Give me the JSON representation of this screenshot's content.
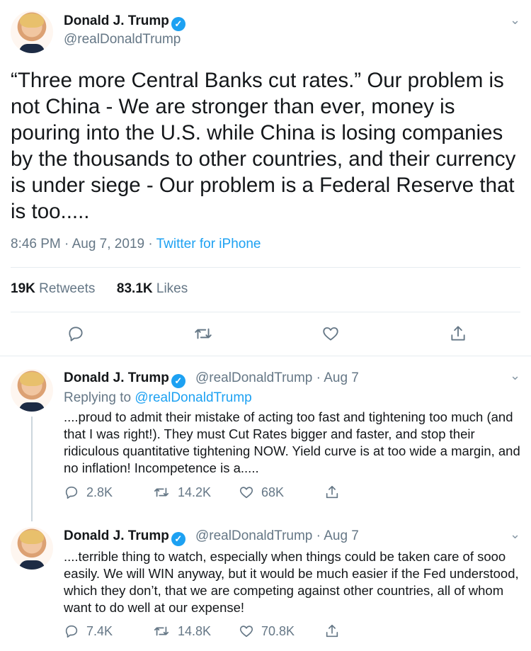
{
  "main_tweet": {
    "author_name": "Donald J. Trump",
    "author_handle": "@realDonaldTrump",
    "text": "“Three more Central Banks cut rates.” Our problem is not China - We are stronger than ever, money is pouring into the U.S. while China is losing companies by the thousands to other countries, and their currency is under siege - Our problem is a Federal Reserve that is too.....",
    "time": "8:46 PM · Aug 7, 2019 · ",
    "source": "Twitter for iPhone",
    "retweets_count": "19K",
    "retweets_label": "Retweets",
    "likes_count": "83.1K",
    "likes_label": "Likes"
  },
  "replies": [
    {
      "author_name": "Donald J. Trump",
      "author_handle": "@realDonaldTrump · Aug 7",
      "replying_prefix": "Replying to ",
      "replying_to": "@realDonaldTrump",
      "text": "....proud to admit their mistake of acting too fast and tightening too much (and that I was right!). They must Cut Rates bigger and faster, and stop their ridiculous quantitative tightening NOW. Yield curve is at too wide a margin, and no inflation! Incompetence is a.....",
      "replies": "2.8K",
      "retweets": "14.2K",
      "likes": "68K"
    },
    {
      "author_name": "Donald J. Trump",
      "author_handle": "@realDonaldTrump · Aug 7",
      "text": "....terrible thing to watch, especially when things could be taken care of sooo easily. We will WIN anyway, but it would be much easier if the Fed understood, which they don’t, that we are competing against other countries, all of whom want to do well at our expense!",
      "replies": "7.4K",
      "retweets": "14.8K",
      "likes": "70.8K"
    }
  ],
  "icons": {
    "verified": "verified-badge-icon",
    "more": "chevron-down-icon",
    "reply": "reply-icon",
    "retweet": "retweet-icon",
    "like": "heart-icon",
    "share": "share-icon"
  },
  "colors": {
    "accent": "#1da1f2",
    "text": "#14171a",
    "muted": "#657786",
    "border": "#e6ecf0"
  }
}
